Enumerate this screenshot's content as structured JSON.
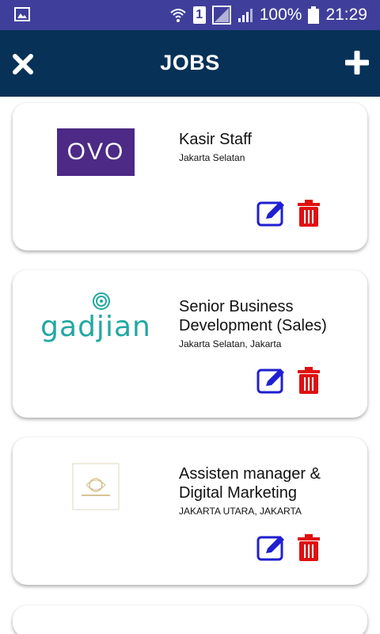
{
  "status_bar": {
    "battery": "100%",
    "time": "21:29",
    "sim": "1"
  },
  "app_bar": {
    "title": "JOBS"
  },
  "jobs": [
    {
      "title": "Kasir Staff",
      "location": "Jakarta Selatan",
      "logo_text": "OVO",
      "logo_color": "#4c2a86"
    },
    {
      "title": "Senior Business Development (Sales)",
      "location": "Jakarta Selatan, Jakarta",
      "logo_text": "gadjian",
      "logo_color": "#22a8a3"
    },
    {
      "title": "Assisten manager & Digital Marketing",
      "location": "JAKARTA UTARA, JAKARTA",
      "logo_text": "",
      "logo_color": "#c8a96a"
    }
  ],
  "colors": {
    "statusbar": "#3f3f9b",
    "appbar": "#073157",
    "edit": "#1f1fd0",
    "delete": "#e01010"
  }
}
